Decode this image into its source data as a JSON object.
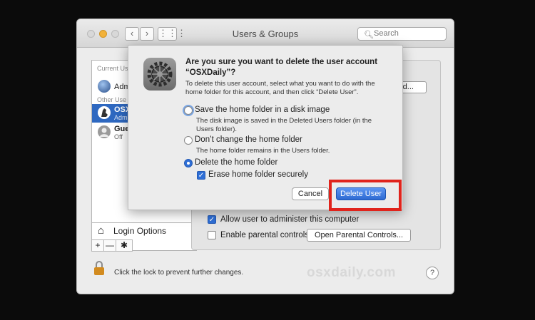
{
  "window": {
    "title": "Users & Groups",
    "search_placeholder": "Search",
    "nav": {
      "back": "‹",
      "forward": "›",
      "grid": "⋮⋮⋮"
    }
  },
  "sidebar": {
    "current_header": "Current Us",
    "current_user": {
      "name": "Adm",
      "status": ""
    },
    "other_header": "Other Use",
    "users": [
      {
        "name": "OSX",
        "status": "Adm",
        "selected": true
      },
      {
        "name": "Gue",
        "status": "Off",
        "selected": false
      }
    ],
    "login_options": "Login Options",
    "buttons": {
      "add": "+",
      "remove": "—",
      "action": "✱"
    }
  },
  "main": {
    "password_button": "rd...",
    "allow_admin_label": "Allow user to administer this computer",
    "allow_admin_checked": true,
    "parental_label": "Enable parental controls",
    "parental_checked": false,
    "parental_button": "Open Parental Controls..."
  },
  "footer": {
    "lock_text": "Click the lock to prevent further changes.",
    "watermark": "osxdaily.com",
    "help": "?"
  },
  "dialog": {
    "question": "Are you sure you want to delete the user account “OSXDaily”?",
    "description": "To delete this user account, select what you want to do with the home folder for this account, and then click “Delete User”.",
    "options": [
      {
        "label": "Save the home folder in a disk image",
        "sub": "The disk image is saved in the Deleted Users folder (in the Users folder).",
        "selected": false
      },
      {
        "label": "Don’t change the home folder",
        "sub": "The home folder remains in the Users folder.",
        "selected": false
      },
      {
        "label": "Delete the home folder",
        "sub": "",
        "selected": true
      }
    ],
    "erase_label": "Erase home folder securely",
    "erase_checked": true,
    "cancel": "Cancel",
    "delete": "Delete User",
    "highlight_color": "#e0241c"
  }
}
